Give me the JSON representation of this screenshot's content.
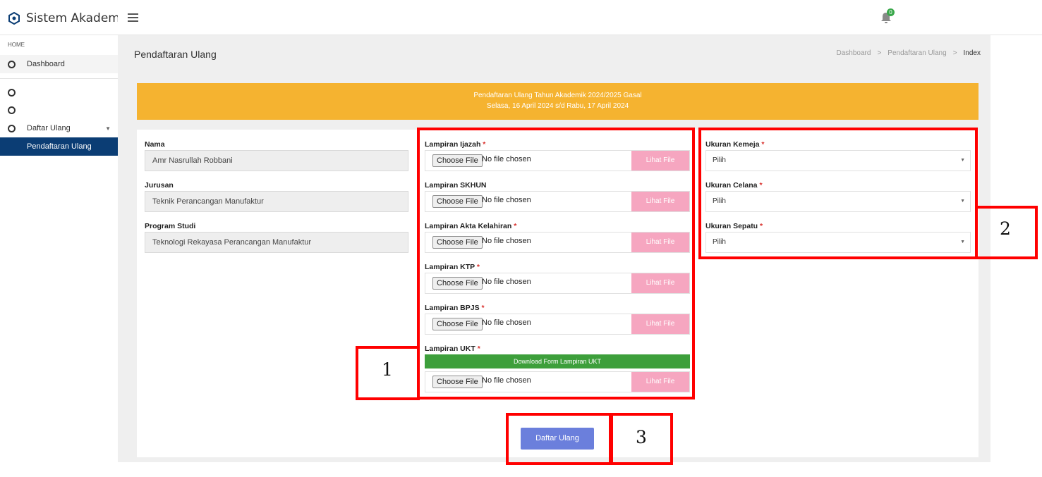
{
  "app": {
    "title": "Sistem Akademik",
    "notification_count": "0"
  },
  "sidebar": {
    "section": "HOME",
    "dashboard": "Dashboard",
    "daftar_ulang": "Daftar Ulang",
    "active_item": "Pendaftaran Ulang"
  },
  "page": {
    "title": "Pendaftaran Ulang",
    "breadcrumb": [
      "Dashboard",
      ">",
      "Pendaftaran Ulang",
      ">",
      "Index"
    ]
  },
  "banner": {
    "line1": "Pendaftaran Ulang Tahun Akademik 2024/2025 Gasal",
    "line2": "Selasa, 16 April 2024 s/d Rabu, 17 April 2024"
  },
  "student": {
    "name_label": "Nama",
    "name_value": "Amr Nasrullah Robbani",
    "jurusan_label": "Jurusan",
    "jurusan_value": "Teknik Perancangan Manufaktur",
    "prodi_label": "Program Studi",
    "prodi_value": "Teknologi Rekayasa Perancangan Manufaktur"
  },
  "file_input": {
    "choose_label": "Choose File",
    "no_file": "No file chosen",
    "view_label": "Lihat File"
  },
  "attachments": [
    {
      "label": "Lampiran Ijazah",
      "required": "*"
    },
    {
      "label": "Lampiran SKHUN",
      "required": ""
    },
    {
      "label": "Lampiran Akta Kelahiran",
      "required": "*"
    },
    {
      "label": "Lampiran KTP",
      "required": "*"
    },
    {
      "label": "Lampiran BPJS",
      "required": "*"
    },
    {
      "label": "Lampiran UKT",
      "required": "*"
    }
  ],
  "ukt_download_label": "Download Form Lampiran UKT",
  "sizes": [
    {
      "label": "Ukuran Kemeja",
      "required": "*",
      "value": "Pilih"
    },
    {
      "label": "Ukuran Celana",
      "required": "*",
      "value": "Pilih"
    },
    {
      "label": "Ukuran Sepatu",
      "required": "*",
      "value": "Pilih"
    }
  ],
  "submit_label": "Daftar Ulang",
  "callouts": [
    "1",
    "2",
    "3"
  ],
  "colors": {
    "banner": "#f5b330",
    "sidebar_active": "#0b3d74",
    "view_button": "#f6a6c0",
    "download_button": "#3d9f3b",
    "submit": "#6b7fdc",
    "callout": "#ff0000"
  }
}
